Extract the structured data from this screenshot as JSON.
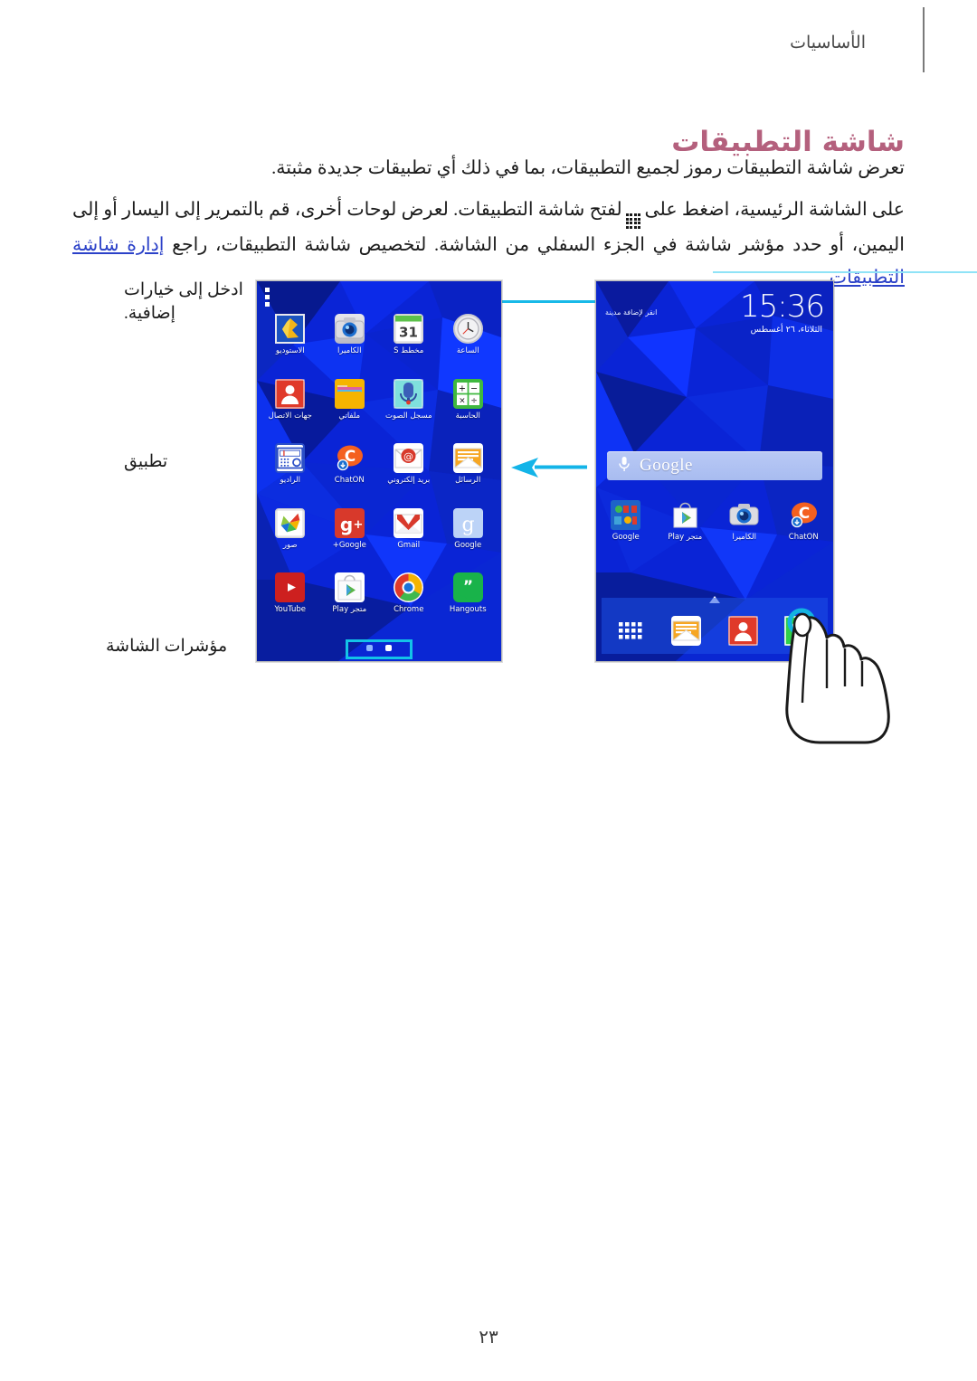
{
  "header": {
    "section_label": "الأساسيات"
  },
  "title": "شاشة التطبيقات",
  "paragraphs": {
    "p1": "تعرض شاشة التطبيقات رموز لجميع التطبيقات، بما في ذلك أي تطبيقات جديدة مثبتة.",
    "p2_a": "على الشاشة الرئيسية، اضغط على",
    "p2_b": "لفتح شاشة التطبيقات. لعرض لوحات أخرى، قم بالتمرير إلى اليسار أو إلى اليمين، أو حدد مؤشر شاشة في الجزء السفلي من الشاشة. لتخصيص شاشة التطبيقات، راجع",
    "p2_link": "إدارة شاشة التطبيقات",
    "p2_c": "."
  },
  "callouts": {
    "options": "ادخل إلى خيارات إضافية.",
    "application": "تطبيق",
    "indicators": "مؤشرات الشاشة"
  },
  "apps_screen": {
    "menu_icon": "more-options-icon",
    "apps": [
      {
        "label": "الساعة",
        "icon": "clock-icon"
      },
      {
        "label": "مخطط S",
        "icon": "s-planner-icon",
        "day": "31"
      },
      {
        "label": "الكاميرا",
        "icon": "camera-icon"
      },
      {
        "label": "الاستوديو",
        "icon": "gallery-icon"
      },
      {
        "label": "الحاسبة",
        "icon": "calculator-icon"
      },
      {
        "label": "مسجل الصوت",
        "icon": "voice-recorder-icon"
      },
      {
        "label": "ملفاتي",
        "icon": "my-files-icon"
      },
      {
        "label": "جهات الاتصال",
        "icon": "contacts-icon"
      },
      {
        "label": "الرسائل",
        "icon": "messages-icon"
      },
      {
        "label": "بريد إلكتروني",
        "icon": "email-icon"
      },
      {
        "label": "ChatON",
        "icon": "chaton-icon"
      },
      {
        "label": "الراديو",
        "icon": "radio-icon"
      },
      {
        "label": "Google",
        "icon": "google-search-icon"
      },
      {
        "label": "Gmail",
        "icon": "gmail-icon"
      },
      {
        "label": "Google+",
        "icon": "google-plus-icon"
      },
      {
        "label": "صور",
        "icon": "photos-icon"
      },
      {
        "label": "Hangouts",
        "icon": "hangouts-icon"
      },
      {
        "label": "Chrome",
        "icon": "chrome-icon"
      },
      {
        "label": "متجر Play",
        "icon": "play-store-icon"
      },
      {
        "label": "YouTube",
        "icon": "youtube-icon"
      }
    ],
    "page_dots": 2,
    "active_dot": 0
  },
  "home_screen": {
    "clock_time": "15:36",
    "clock_date": "الثلاثاء، ٢٦ أغسطس",
    "add_city": "انقر لإضافة مدينة",
    "search_text": "Google",
    "search_mic_icon": "microphone-icon",
    "apps": [
      {
        "label": "ChatON",
        "icon": "chaton-icon"
      },
      {
        "label": "الكاميرا",
        "icon": "camera-icon"
      },
      {
        "label": "متجر Play",
        "icon": "play-store-icon"
      },
      {
        "label": "Google",
        "icon": "google-folder-icon"
      }
    ],
    "dock": [
      {
        "label": "phone",
        "icon": "phone-icon"
      },
      {
        "label": "contacts",
        "icon": "contacts-icon"
      },
      {
        "label": "messages",
        "icon": "messages-icon"
      },
      {
        "label": "apps",
        "icon": "apps-grid-icon"
      }
    ],
    "home_indicator_icon": "home-indicator-icon"
  },
  "gesture": {
    "hand_icon": "tapping-hand-icon",
    "tap_ring_color": "#13b4e0"
  },
  "arrow": {
    "icon": "left-arrow-icon",
    "color": "#13b4e0"
  },
  "page_number": "٢٣",
  "colors": {
    "title": "#b4607d",
    "link": "#2b41c8",
    "leader": "#18b9e8",
    "screen_blue": "#0a1fd0"
  }
}
